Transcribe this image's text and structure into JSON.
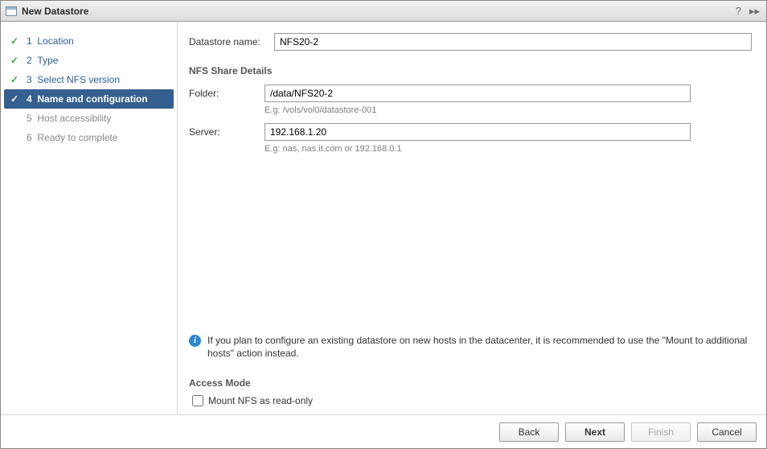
{
  "title": "New Datastore",
  "steps": [
    {
      "num": "1",
      "label": "Location",
      "state": "completed"
    },
    {
      "num": "2",
      "label": "Type",
      "state": "completed"
    },
    {
      "num": "3",
      "label": "Select NFS version",
      "state": "completed"
    },
    {
      "num": "4",
      "label": "Name and configuration",
      "state": "current"
    },
    {
      "num": "5",
      "label": "Host accessibility",
      "state": "pending"
    },
    {
      "num": "6",
      "label": "Ready to complete",
      "state": "pending"
    }
  ],
  "form": {
    "datastore_name_label": "Datastore name:",
    "datastore_name_value": "NFS20-2",
    "nfs_section_title": "NFS Share Details",
    "folder_label": "Folder:",
    "folder_value": "/data/NFS20-2",
    "folder_hint": "E.g: /vols/vol0/datastore-001",
    "server_label": "Server:",
    "server_value": "192.168.1.20",
    "server_hint": "E.g: nas, nas.it.com or 192.168.0.1",
    "info_text": "If you plan to configure an existing datastore on new hosts in the datacenter, it is recommended to use the \"Mount to additional hosts\" action instead.",
    "access_section_title": "Access Mode",
    "readonly_label": "Mount NFS as read-only",
    "readonly_checked": false
  },
  "buttons": {
    "back": "Back",
    "next": "Next",
    "finish": "Finish",
    "cancel": "Cancel"
  }
}
